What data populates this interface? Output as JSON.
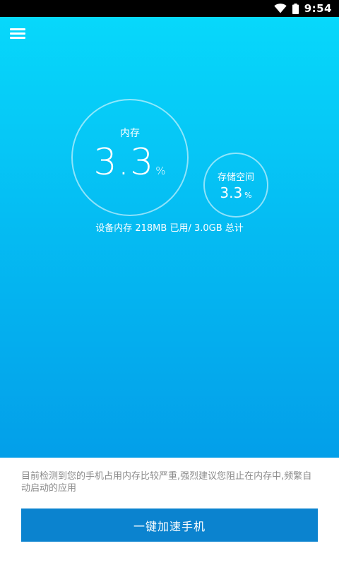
{
  "status_bar": {
    "time": "9:54",
    "icons": [
      "wifi-icon",
      "battery-icon"
    ]
  },
  "header": {
    "menu_icon": "menu-icon"
  },
  "memory": {
    "label": "内存",
    "value": "3.3",
    "unit": "%"
  },
  "storage": {
    "label": "存储空间",
    "value": "3.3",
    "unit": "%"
  },
  "summary": "设备内存 218MB 已用/ 3.0GB 总计",
  "notice": "目前检测到您的手机占用内存比较严重,强烈建议您阻止在内存中,频繁自动启动的应用",
  "boost_button": {
    "label": "一键加速手机"
  },
  "colors": {
    "gradient_top": "#07d8fb",
    "gradient_bottom": "#039fe9",
    "button": "#0b83cf",
    "notice_text": "#8a8a8a"
  }
}
